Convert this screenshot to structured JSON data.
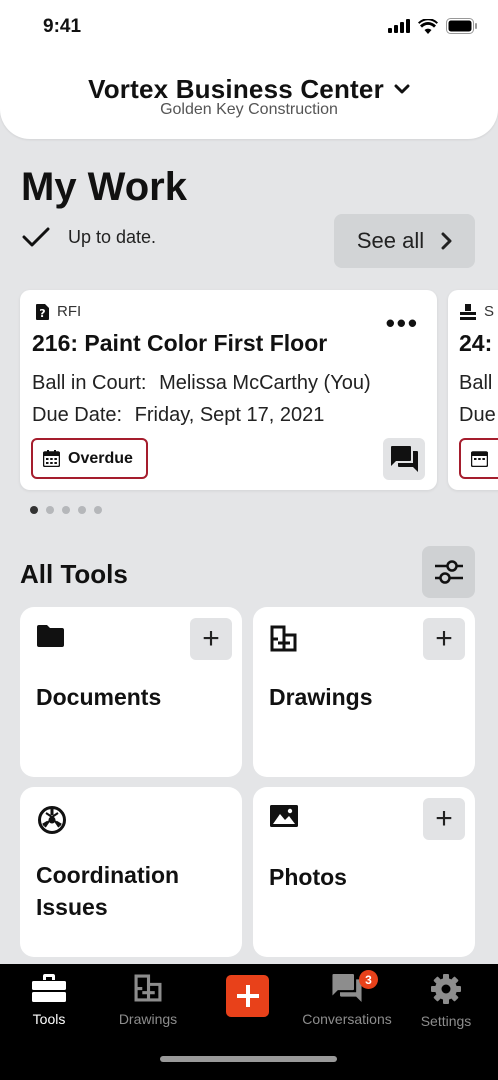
{
  "status": {
    "time": "9:41"
  },
  "project": {
    "name": "Vortex Business Center",
    "company": "Golden Key Construction"
  },
  "mywork": {
    "title": "My Work",
    "status": "Up to date.",
    "see_all": "See all",
    "card": {
      "type": "RFI",
      "title": "216: Paint Color First Floor",
      "ball_label": "Ball in Court:",
      "ball_value": "Melissa McCarthy (You)",
      "due_label": "Due Date:",
      "due_value": "Friday, Sept 17, 2021",
      "status_badge": "Overdue"
    },
    "next_card": {
      "type": "S",
      "title": "24:",
      "line1": "Ball",
      "line2": "Due"
    },
    "pager": {
      "count": 5,
      "active": 1
    }
  },
  "tools": {
    "title": "All Tools",
    "items": [
      {
        "name": "Documents",
        "icon": "folder-icon",
        "has_add": true
      },
      {
        "name": "Drawings",
        "icon": "drawings-icon",
        "has_add": true
      },
      {
        "name_line1": "Coordination",
        "name_line2": "Issues",
        "icon": "coordination-icon",
        "has_add": false
      },
      {
        "name": "Photos",
        "icon": "photo-icon",
        "has_add": true
      }
    ]
  },
  "tabbar": {
    "items": [
      {
        "label": "Tools",
        "icon": "toolbox-icon",
        "active": true
      },
      {
        "label": "Drawings",
        "icon": "drawings-icon",
        "active": false
      },
      {
        "label": "Conversations",
        "icon": "chat-icon",
        "active": false,
        "badge": "3"
      },
      {
        "label": "Settings",
        "icon": "gear-icon",
        "active": false
      }
    ],
    "accent_color": "#E8411A"
  },
  "colors": {
    "overdue_border": "#A51D2D",
    "background": "#E4E5E7"
  }
}
